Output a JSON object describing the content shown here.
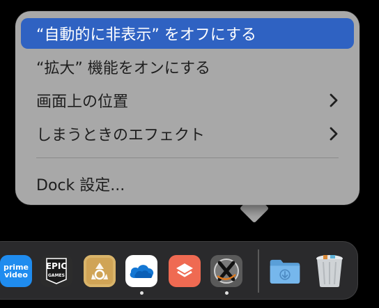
{
  "context_menu": {
    "items": [
      {
        "label": "“自動的に非表示” をオフにする",
        "selected": true
      },
      {
        "label": "“拡大” 機能をオンにする",
        "selected": false
      },
      {
        "label": "画面上の位置",
        "submenu": true
      },
      {
        "label": "しまうときのエフェクト",
        "submenu": true
      },
      {
        "label": "Dock 設定..."
      }
    ]
  },
  "dock": {
    "apps": [
      {
        "name": "prime video",
        "line1": "prime",
        "line2": "video",
        "color": "#1f8cef"
      },
      {
        "name": "epic games",
        "line1": "EPIC",
        "line2": "GAMES",
        "color": "#2c2c2c"
      },
      {
        "name": "recycle app",
        "color": "#d9b46a"
      },
      {
        "name": "onedrive",
        "color": "#ffffff"
      },
      {
        "name": "layers app",
        "color": "#ef6a52"
      },
      {
        "name": "x11 app",
        "color": "#5a5a5a"
      },
      {
        "name": "downloads folder",
        "color": "#6fb0e6"
      },
      {
        "name": "trash",
        "color": "#cfd3d6"
      }
    ]
  },
  "colors": {
    "menu_bg": "#a8a8a8",
    "selection": "#2f62c2",
    "dock_bg": "#2a2a2c"
  }
}
